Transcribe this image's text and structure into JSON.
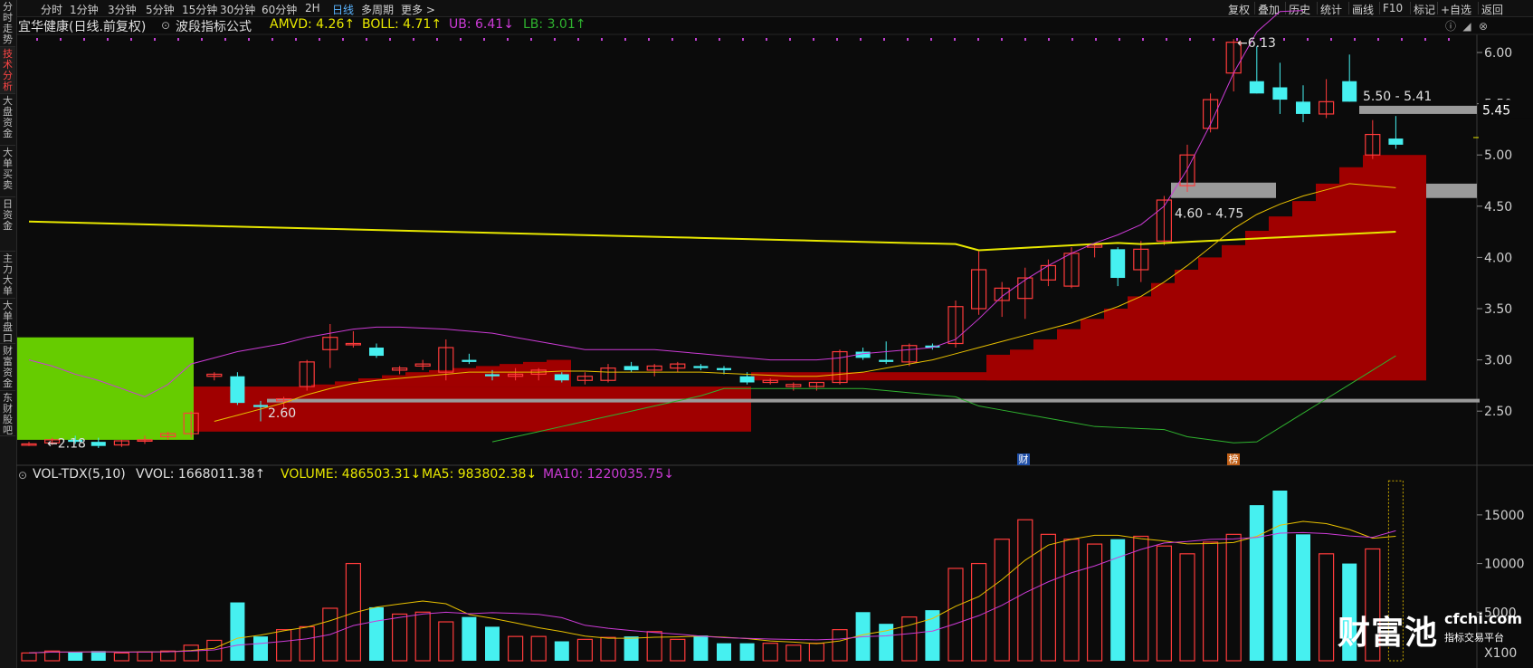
{
  "left_tabs": [
    {
      "label": "分时走势",
      "active": false
    },
    {
      "label": "技术分析",
      "active": true
    },
    {
      "label": "大盘资金",
      "active": false
    },
    {
      "label": "大单买卖",
      "active": false
    },
    {
      "label": "日资金",
      "active": false
    },
    {
      "label": "主力大单",
      "active": false
    },
    {
      "label": "大单盘口",
      "active": false
    },
    {
      "label": "财富资金",
      "active": false
    },
    {
      "label": "东财股吧",
      "active": false
    }
  ],
  "periods": [
    "分时",
    "1分钟",
    "3分钟",
    "5分钟",
    "15分钟",
    "30分钟",
    "60分钟",
    "2H",
    "日线",
    "多周期",
    "更多 >"
  ],
  "active_period": "日线",
  "right_tools": [
    "复权",
    "叠加",
    "历史",
    "统计",
    "画线",
    "F10",
    "标记",
    "+自选",
    "返回"
  ],
  "info_line1": {
    "stock": "宜华健康(日线.前复权)",
    "formula": "波段指标公式",
    "amvd": "AMVD: 4.26↑",
    "boll": "BOLL: 4.71↑",
    "ub": "UB: 6.41↓",
    "lb": "LB: 3.01↑"
  },
  "info_line2": {
    "vol_name": "VOL-TDX(5,10)",
    "vvol": "VVOL: 1668011.38↑",
    "volume": "VOLUME: 486503.31↓",
    "ma5": "MA5: 983802.38↓",
    "ma10": "MA10: 1220035.75↓"
  },
  "price_axis": [
    "6.00",
    "5.50",
    "5.00",
    "4.50",
    "4.00",
    "3.50",
    "3.00",
    "2.50"
  ],
  "volume_axis": [
    "15000",
    "10000",
    "5000",
    "X100"
  ],
  "annotations": {
    "high": "6.13",
    "low": "2.18",
    "support": "2.60",
    "zone_upper": "5.50 - 5.41",
    "zone_mid": "4.60 - 4.75",
    "current_price": "5.45",
    "marker_cai": "财",
    "marker_bang": "榜"
  },
  "colors": {
    "up": "#ff3b3b",
    "down": "#46f0f0",
    "boll_mid": "#e8e800",
    "ub": "#cc3bd6",
    "lb": "#2fb32f",
    "fill_red": "#a00000",
    "fill_green": "#66cc00",
    "zone_gray": "#9a9a9a"
  },
  "watermark": {
    "brand": "财富池",
    "site": "cfchi.com",
    "sub": "指标交易平台"
  },
  "chart_data": {
    "type": "candlestick",
    "ohlc": [
      [
        2.18,
        2.2,
        2.16,
        2.18
      ],
      [
        2.19,
        2.24,
        2.17,
        2.22
      ],
      [
        2.22,
        2.26,
        2.18,
        2.2
      ],
      [
        2.2,
        2.24,
        2.14,
        2.16
      ],
      [
        2.17,
        2.22,
        2.15,
        2.21
      ],
      [
        2.21,
        2.26,
        2.18,
        2.22
      ],
      [
        2.25,
        2.3,
        2.22,
        2.28
      ],
      [
        2.28,
        2.5,
        2.24,
        2.48
      ],
      [
        2.84,
        2.88,
        2.8,
        2.86
      ],
      [
        2.84,
        2.88,
        2.56,
        2.58
      ],
      [
        2.56,
        2.6,
        2.4,
        2.54
      ],
      [
        2.6,
        2.64,
        2.52,
        2.62
      ],
      [
        2.74,
        3.0,
        2.7,
        2.98
      ],
      [
        3.1,
        3.35,
        2.92,
        3.22
      ],
      [
        3.15,
        3.28,
        3.12,
        3.16
      ],
      [
        3.12,
        3.16,
        3.02,
        3.04
      ],
      [
        2.9,
        2.94,
        2.86,
        2.92
      ],
      [
        2.94,
        3.0,
        2.9,
        2.96
      ],
      [
        2.88,
        3.2,
        2.8,
        3.12
      ],
      [
        3.0,
        3.06,
        2.96,
        2.98
      ],
      [
        2.86,
        2.9,
        2.8,
        2.84
      ],
      [
        2.84,
        2.92,
        2.8,
        2.86
      ],
      [
        2.86,
        2.92,
        2.8,
        2.9
      ],
      [
        2.86,
        2.88,
        2.78,
        2.8
      ],
      [
        2.8,
        2.88,
        2.76,
        2.84
      ],
      [
        2.8,
        2.96,
        2.78,
        2.92
      ],
      [
        2.94,
        2.98,
        2.88,
        2.9
      ],
      [
        2.9,
        2.96,
        2.84,
        2.94
      ],
      [
        2.92,
        2.98,
        2.88,
        2.96
      ],
      [
        2.94,
        2.96,
        2.9,
        2.92
      ],
      [
        2.92,
        2.94,
        2.86,
        2.9
      ],
      [
        2.84,
        2.88,
        2.76,
        2.78
      ],
      [
        2.78,
        2.82,
        2.76,
        2.8
      ],
      [
        2.74,
        2.78,
        2.7,
        2.76
      ],
      [
        2.74,
        2.78,
        2.7,
        2.78
      ],
      [
        2.78,
        3.1,
        2.76,
        3.08
      ],
      [
        3.08,
        3.12,
        3.0,
        3.02
      ],
      [
        3.0,
        3.18,
        2.96,
        2.98
      ],
      [
        2.98,
        3.16,
        2.94,
        3.14
      ],
      [
        3.14,
        3.16,
        3.1,
        3.12
      ],
      [
        3.16,
        3.58,
        3.12,
        3.52
      ],
      [
        3.5,
        4.06,
        3.44,
        3.88
      ],
      [
        3.58,
        3.76,
        3.42,
        3.7
      ],
      [
        3.6,
        3.9,
        3.4,
        3.8
      ],
      [
        3.78,
        3.98,
        3.72,
        3.92
      ],
      [
        3.72,
        4.1,
        3.7,
        4.04
      ],
      [
        4.1,
        4.14,
        4.0,
        4.12
      ],
      [
        4.08,
        4.1,
        3.72,
        3.8
      ],
      [
        3.88,
        4.16,
        3.76,
        4.08
      ],
      [
        4.16,
        4.6,
        4.12,
        4.56
      ],
      [
        4.7,
        5.1,
        4.64,
        5.0
      ],
      [
        5.26,
        5.6,
        5.22,
        5.54
      ],
      [
        5.8,
        6.13,
        5.62,
        6.1
      ],
      [
        5.72,
        6.06,
        5.6,
        5.6
      ],
      [
        5.66,
        5.9,
        5.4,
        5.54
      ],
      [
        5.52,
        5.68,
        5.32,
        5.4
      ],
      [
        5.4,
        5.74,
        5.36,
        5.52
      ],
      [
        5.72,
        5.98,
        5.52,
        5.52
      ],
      [
        5.0,
        5.34,
        4.96,
        5.2
      ],
      [
        5.16,
        5.38,
        5.06,
        5.1
      ]
    ],
    "volume": [
      8,
      10,
      9,
      10,
      8,
      9,
      10,
      16,
      21,
      60,
      25,
      32,
      35,
      54,
      100,
      55,
      48,
      50,
      40,
      45,
      35,
      25,
      25,
      20,
      22,
      24,
      25,
      30,
      22,
      26,
      18,
      18,
      18,
      16,
      18,
      32,
      50,
      38,
      45,
      52,
      95,
      100,
      125,
      145,
      130,
      125,
      120,
      125,
      128,
      118,
      110,
      122,
      130,
      160,
      175,
      130,
      110,
      100,
      115,
      185
    ]
  }
}
